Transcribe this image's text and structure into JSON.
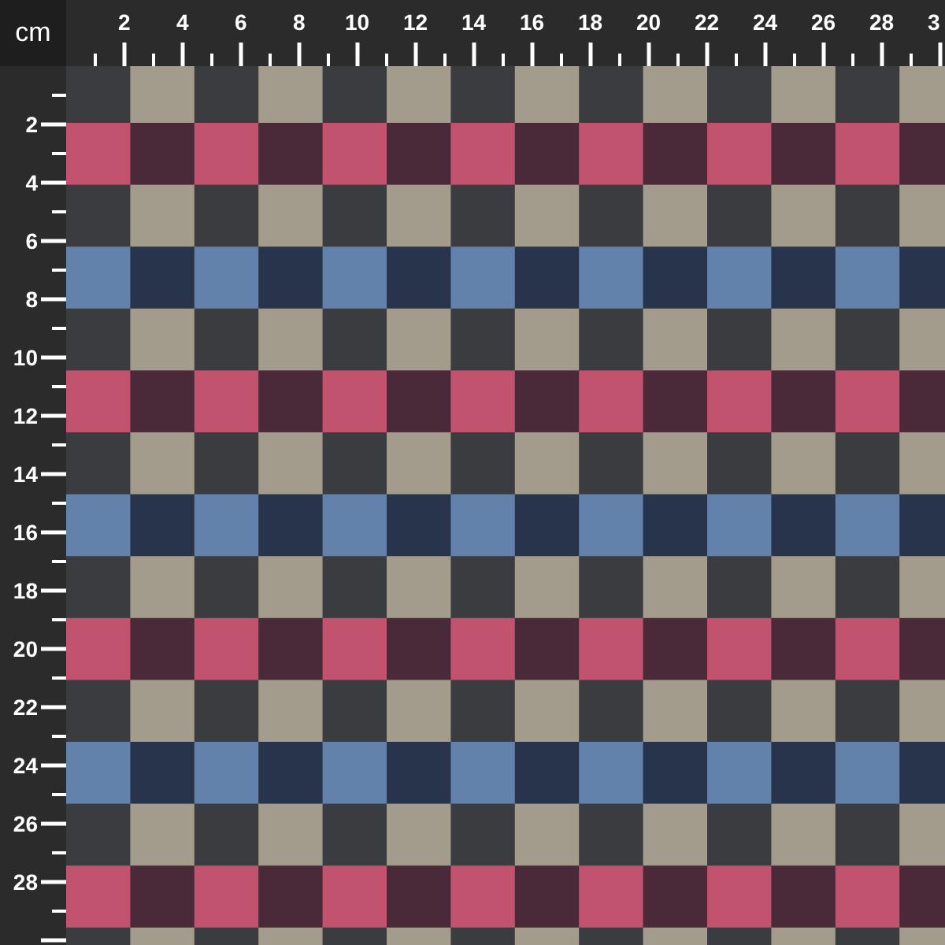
{
  "unit": "cm",
  "top_ruler": {
    "labels": [
      "2",
      "4",
      "6",
      "8",
      "10",
      "12",
      "14",
      "16",
      "18",
      "20",
      "22",
      "24",
      "26",
      "28",
      "3"
    ]
  },
  "left_ruler": {
    "labels": [
      "2",
      "4",
      "6",
      "8",
      "10",
      "12",
      "14",
      "16",
      "18",
      "20",
      "22",
      "24",
      "26",
      "28"
    ]
  }
}
